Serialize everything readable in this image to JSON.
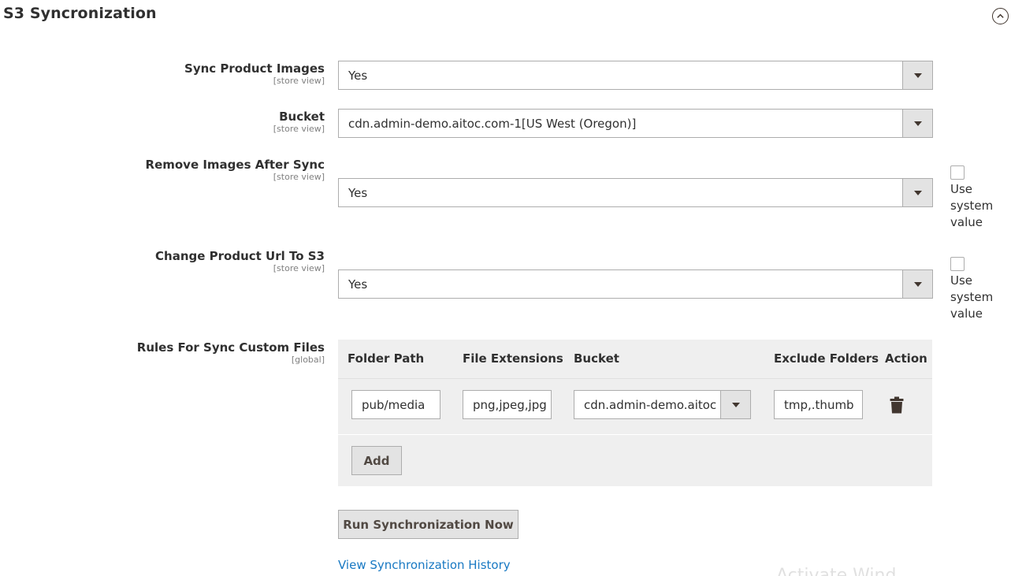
{
  "section": {
    "title": "S3 Syncronization"
  },
  "fields": {
    "sync_product_images": {
      "label": "Sync Product Images",
      "scope": "[store view]",
      "value": "Yes"
    },
    "bucket": {
      "label": "Bucket",
      "scope": "[store view]",
      "value": "cdn.admin-demo.aitoc.com-1[US West (Oregon)]"
    },
    "remove_images": {
      "label": "Remove Images After Sync",
      "scope": "[store view]",
      "value": "Yes",
      "use_system_label": "Use system value"
    },
    "change_url": {
      "label": "Change Product Url To S3",
      "scope": "[store view]",
      "value": "Yes",
      "use_system_label": "Use system value"
    },
    "rules": {
      "label": "Rules For Sync Custom Files",
      "scope": "[global]"
    }
  },
  "rules_table": {
    "headers": {
      "folder_path": "Folder Path",
      "file_extensions": "File Extensions",
      "bucket": "Bucket",
      "exclude_folders": "Exclude Folders",
      "action": "Action"
    },
    "rows": [
      {
        "folder_path": "pub/media",
        "file_extensions": "png,jpeg,jpg",
        "bucket": "cdn.admin-demo.aitoc",
        "exclude_folders": "tmp,.thumb"
      }
    ],
    "add_label": "Add"
  },
  "actions": {
    "run_label": "Run Synchronization Now",
    "history_label": "View Synchronization History"
  },
  "watermark": "Activate Wind"
}
